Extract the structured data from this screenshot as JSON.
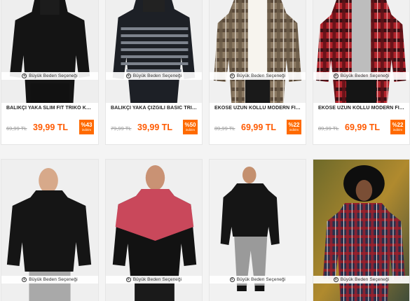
{
  "size_note": "Büyük Beden Seçeneği",
  "products_row1": [
    {
      "title": "BALIKÇI YAKA SLİM FİT TRİKO KAZAK",
      "old_price": "69,99 TL",
      "price": "39,99 TL",
      "discount_pct": "%43",
      "discount_label": "indirim"
    },
    {
      "title": "BALIKÇI YAKA ÇİZGİLİ BASİC TRİKO K...",
      "old_price": "79,99 TL",
      "price": "39,99 TL",
      "discount_pct": "%50",
      "discount_label": "indirim"
    },
    {
      "title": "EKOSE UZUN KOLLU MODERN FİT GÖ...",
      "old_price": "89,99 TL",
      "price": "69,99 TL",
      "discount_pct": "%22",
      "discount_label": "indirim"
    },
    {
      "title": "EKOSE UZUN KOLLU MODERN FİT GÖ...",
      "old_price": "89,99 TL",
      "price": "69,99 TL",
      "discount_pct": "%22",
      "discount_label": "indirim"
    }
  ],
  "colors": {
    "accent": "#ff5a00",
    "badge": "#ff6a00"
  }
}
